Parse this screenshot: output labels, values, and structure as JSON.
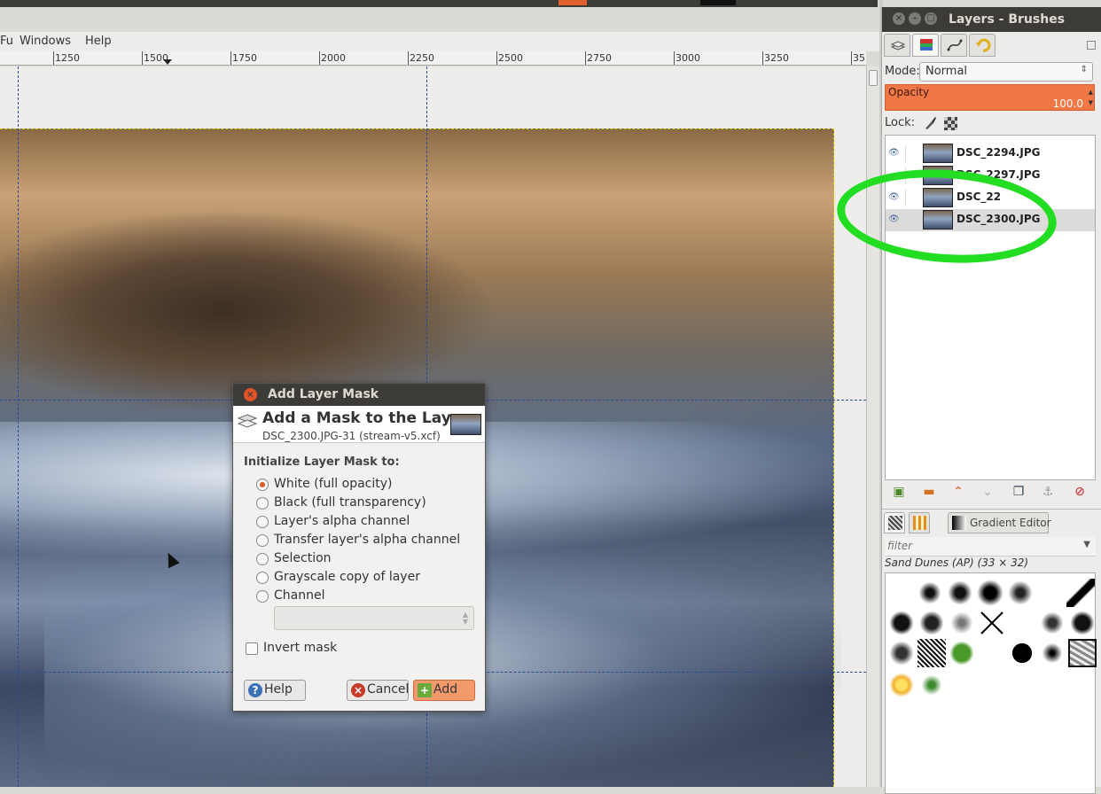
{
  "menubar": {
    "items": [
      "Fu",
      "Windows",
      "Help"
    ]
  },
  "ruler": {
    "ticks": [
      "1250",
      "1500",
      "1750",
      "2000",
      "2250",
      "2500",
      "2750",
      "3000",
      "3250",
      "35"
    ]
  },
  "dock": {
    "title": "Layers - Brushes",
    "mode_label": "Mode:",
    "mode_value": "Normal",
    "opacity_label": "Opacity",
    "opacity_value": "100.0",
    "lock_label": "Lock:",
    "layers": [
      {
        "name": "DSC_2294.JPG",
        "visible": true
      },
      {
        "name": "DSC_2297.JPG",
        "visible": false
      },
      {
        "name": "DSC_22",
        "visible": true
      },
      {
        "name": "DSC_2300.JPG",
        "visible": true,
        "selected": true
      }
    ],
    "gradient_tab_label": "Gradient Editor",
    "filter_placeholder": "filter",
    "brush_name": "Sand Dunes (AP) (33 × 32)",
    "highlight_color": "#22dd22",
    "accent_color": "#f07746"
  },
  "dialog": {
    "title": "Add Layer Mask",
    "heading": "Add a Mask to the Layer",
    "subtitle": "DSC_2300.JPG-31 (stream-v5.xcf)",
    "prompt": "Initialize Layer Mask to:",
    "options": [
      {
        "label": "White (full opacity)",
        "checked": true
      },
      {
        "label": "Black (full transparency)",
        "checked": false
      },
      {
        "label": "Layer's alpha channel",
        "checked": false
      },
      {
        "label": "Transfer layer's alpha channel",
        "checked": false
      },
      {
        "label": "Selection",
        "checked": false
      },
      {
        "label": "Grayscale copy of layer",
        "checked": false
      },
      {
        "label": "Channel",
        "checked": false
      }
    ],
    "invert_label": "Invert mask",
    "invert_checked": false,
    "buttons": {
      "help": "Help",
      "cancel": "Cancel",
      "add": "Add"
    }
  }
}
